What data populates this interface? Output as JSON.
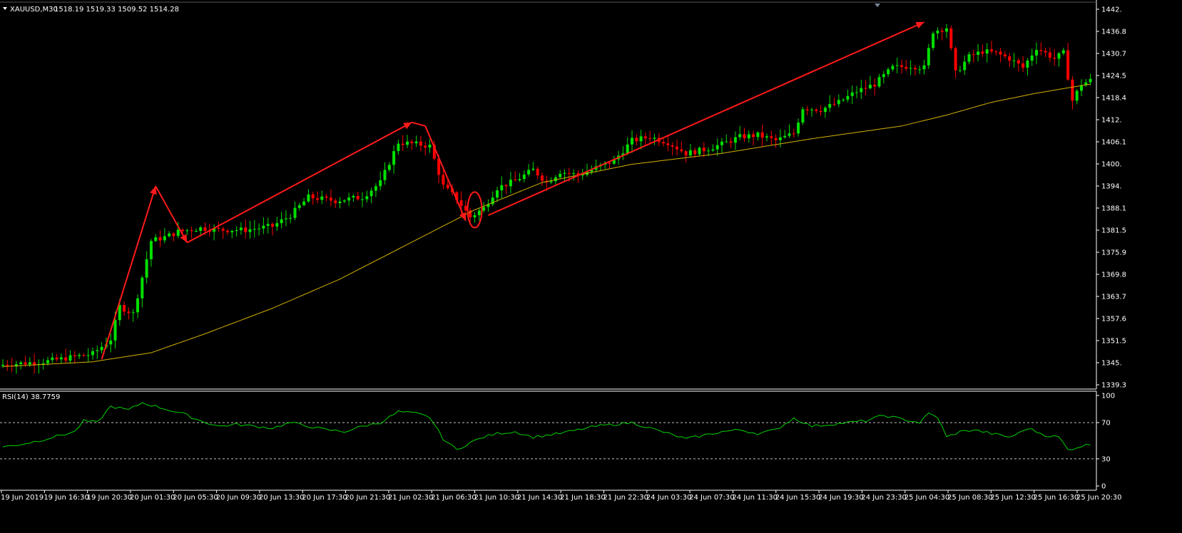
{
  "header": {
    "symbol": "XAUUSD,M30",
    "ohlc": "1518.19 1519.33 1509.52 1514.28"
  },
  "rsi": {
    "label": "RSI(14) 38.7759",
    "ticks": [
      "100",
      "70",
      "30",
      "0"
    ]
  },
  "colors": {
    "background": "#000000",
    "bull": "#00e000",
    "bear": "#ff0000",
    "ma": "#d4b000",
    "rsi_line": "#00d000",
    "annotation": "#ff1a1a",
    "axis": "#ffffff"
  },
  "chart_data": [
    {
      "type": "candlestick",
      "symbol": "XAUUSD",
      "timeframe": "M30",
      "ylim": [
        1339.0,
        1443.0
      ],
      "y_ticks": [
        "1442.",
        "1436.8",
        "1430.7",
        "1424.5",
        "1418.4",
        "1412.",
        "1406.1",
        "1400.",
        "1394.",
        "1388.1",
        "1381.5",
        "1375.9",
        "1369.8",
        "1363.7",
        "1357.6",
        "1351.5",
        "1345.",
        "1339.3"
      ],
      "x_ticks": [
        "19 Jun 2019",
        "19 Jun 16:30",
        "19 Jun 20:30",
        "20 Jun 01:30",
        "20 Jun 05:30",
        "20 Jun 09:30",
        "20 Jun 13:30",
        "20 Jun 17:30",
        "20 Jun 21:30",
        "21 Jun 02:30",
        "21 Jun 06:30",
        "21 Jun 10:30",
        "21 Jun 14:30",
        "21 Jun 18:30",
        "21 Jun 22:30",
        "24 Jun 03:30",
        "24 Jun 07:30",
        "24 Jun 11:30",
        "24 Jun 15:30",
        "24 Jun 19:30",
        "24 Jun 23:30",
        "25 Jun 04:30",
        "25 Jun 08:30",
        "25 Jun 12:30",
        "25 Jun 16:30",
        "25 Jun 20:30"
      ],
      "price_anchors": [
        [
          0,
          1344.5
        ],
        [
          10,
          1345.5
        ],
        [
          20,
          1347.5
        ],
        [
          24,
          1351.5
        ],
        [
          26,
          1360.5
        ],
        [
          29,
          1358.5
        ],
        [
          33,
          1378.5
        ],
        [
          36,
          1379.5
        ],
        [
          39,
          1381.0
        ],
        [
          44,
          1382.0
        ],
        [
          48,
          1381.5
        ],
        [
          54,
          1381.5
        ],
        [
          60,
          1382.5
        ],
        [
          64,
          1385.5
        ],
        [
          68,
          1390.5
        ],
        [
          74,
          1389.5
        ],
        [
          80,
          1390.5
        ],
        [
          84,
          1394.5
        ],
        [
          88,
          1405.5
        ],
        [
          92,
          1405.0
        ],
        [
          95,
          1404.5
        ],
        [
          98,
          1393.5
        ],
        [
          101,
          1390.0
        ],
        [
          104,
          1385.0
        ],
        [
          107,
          1387.5
        ],
        [
          110,
          1393.0
        ],
        [
          114,
          1395.0
        ],
        [
          118,
          1398.0
        ],
        [
          121,
          1394.5
        ],
        [
          124,
          1397.5
        ],
        [
          128,
          1396.5
        ],
        [
          132,
          1398.5
        ],
        [
          136,
          1400.5
        ],
        [
          140,
          1406.0
        ],
        [
          144,
          1407.0
        ],
        [
          148,
          1405.5
        ],
        [
          152,
          1402.5
        ],
        [
          156,
          1403.5
        ],
        [
          160,
          1405.0
        ],
        [
          164,
          1407.0
        ],
        [
          168,
          1407.5
        ],
        [
          172,
          1406.0
        ],
        [
          176,
          1408.0
        ],
        [
          178,
          1415.0
        ],
        [
          182,
          1414.5
        ],
        [
          186,
          1416.5
        ],
        [
          190,
          1419.5
        ],
        [
          194,
          1421.5
        ],
        [
          198,
          1426.0
        ],
        [
          202,
          1426.5
        ],
        [
          205,
          1426.0
        ],
        [
          207,
          1436.0
        ],
        [
          210,
          1437.0
        ],
        [
          212,
          1424.5
        ],
        [
          215,
          1429.0
        ],
        [
          218,
          1430.5
        ],
        [
          221,
          1430.0
        ],
        [
          224,
          1428.5
        ],
        [
          227,
          1426.0
        ],
        [
          230,
          1431.5
        ],
        [
          232,
          1430.0
        ],
        [
          234,
          1428.5
        ],
        [
          236,
          1430.0
        ],
        [
          238,
          1417.0
        ],
        [
          240,
          1421.5
        ],
        [
          242,
          1422.5
        ]
      ],
      "ma_anchors": [
        [
          0,
          1344.0
        ],
        [
          20,
          1345.3
        ],
        [
          33,
          1347.8
        ],
        [
          45,
          1353.0
        ],
        [
          60,
          1360.0
        ],
        [
          75,
          1368.0
        ],
        [
          90,
          1377.5
        ],
        [
          105,
          1387.0
        ],
        [
          120,
          1394.5
        ],
        [
          140,
          1399.5
        ],
        [
          160,
          1402.5
        ],
        [
          180,
          1406.5
        ],
        [
          200,
          1410.0
        ],
        [
          210,
          1413.0
        ],
        [
          220,
          1416.5
        ],
        [
          230,
          1419.0
        ],
        [
          242,
          1421.5
        ]
      ],
      "rsi_anchors": [
        [
          0,
          43
        ],
        [
          4,
          46
        ],
        [
          8,
          50
        ],
        [
          12,
          55
        ],
        [
          16,
          60
        ],
        [
          18,
          72
        ],
        [
          21,
          70
        ],
        [
          24,
          88
        ],
        [
          28,
          84
        ],
        [
          31,
          92
        ],
        [
          34,
          88
        ],
        [
          37,
          84
        ],
        [
          40,
          80
        ],
        [
          44,
          72
        ],
        [
          48,
          66
        ],
        [
          52,
          68
        ],
        [
          56,
          66
        ],
        [
          60,
          64
        ],
        [
          64,
          70
        ],
        [
          68,
          66
        ],
        [
          72,
          62
        ],
        [
          76,
          60
        ],
        [
          80,
          66
        ],
        [
          84,
          70
        ],
        [
          88,
          82
        ],
        [
          92,
          80
        ],
        [
          95,
          76
        ],
        [
          98,
          52
        ],
        [
          101,
          40
        ],
        [
          104,
          48
        ],
        [
          107,
          54
        ],
        [
          110,
          58
        ],
        [
          114,
          60
        ],
        [
          118,
          54
        ],
        [
          121,
          56
        ],
        [
          124,
          58
        ],
        [
          128,
          62
        ],
        [
          132,
          66
        ],
        [
          136,
          68
        ],
        [
          140,
          70
        ],
        [
          144,
          64
        ],
        [
          148,
          58
        ],
        [
          152,
          52
        ],
        [
          156,
          56
        ],
        [
          160,
          60
        ],
        [
          164,
          62
        ],
        [
          168,
          58
        ],
        [
          172,
          62
        ],
        [
          176,
          75
        ],
        [
          180,
          66
        ],
        [
          184,
          68
        ],
        [
          188,
          70
        ],
        [
          192,
          72
        ],
        [
          196,
          78
        ],
        [
          200,
          74
        ],
        [
          204,
          70
        ],
        [
          206,
          80
        ],
        [
          208,
          76
        ],
        [
          210,
          54
        ],
        [
          213,
          60
        ],
        [
          216,
          62
        ],
        [
          220,
          58
        ],
        [
          224,
          54
        ],
        [
          226,
          58
        ],
        [
          228,
          64
        ],
        [
          232,
          56
        ],
        [
          235,
          54
        ],
        [
          237,
          40
        ],
        [
          240,
          44
        ],
        [
          242,
          46
        ]
      ],
      "rsi_ylim": [
        0,
        100
      ],
      "rsi_levels": [
        70,
        30
      ]
    }
  ]
}
